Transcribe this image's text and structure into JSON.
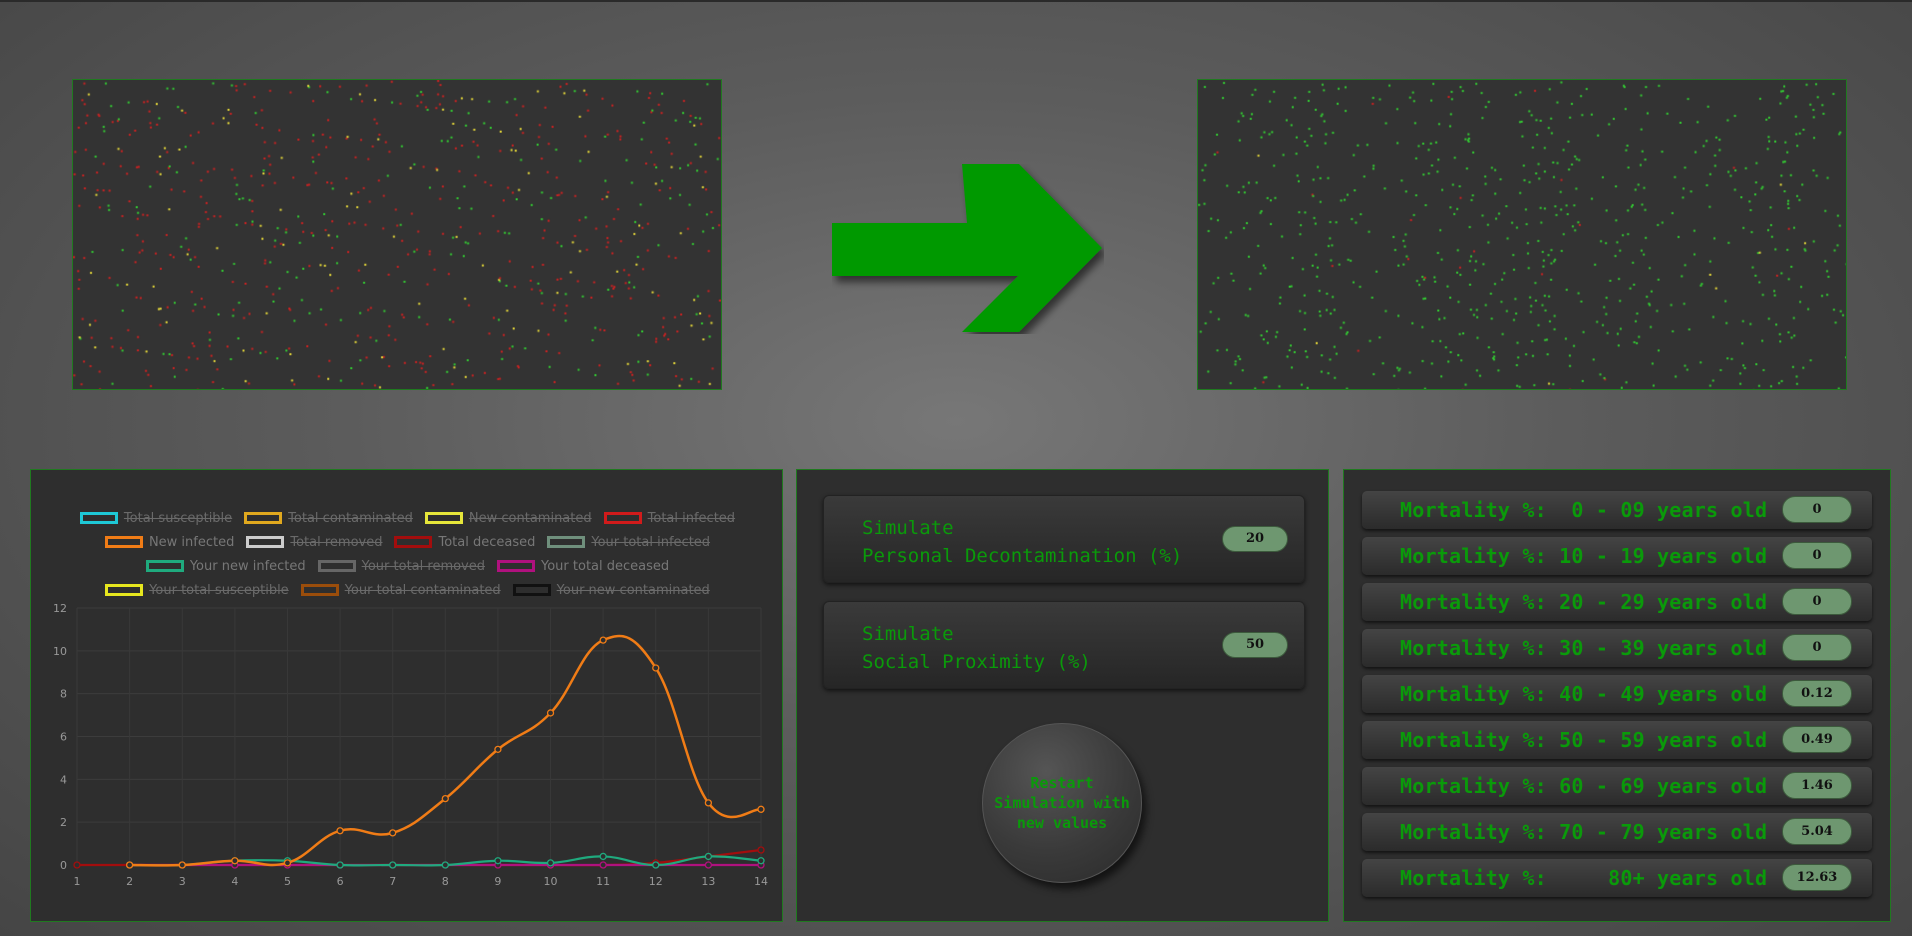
{
  "colors": {
    "accent_green": "#0a9a0a",
    "panel_border": "#1f7a1f",
    "pill_bg": "#6e9770",
    "dot_red": "#cc2222",
    "dot_green": "#33cc33",
    "dot_yellow": "#e6d93a",
    "arrow_green": "#009900"
  },
  "simulation": {
    "before_panel": "infection-simulation-before",
    "after_panel": "infection-simulation-after",
    "arrow_icon": "right-arrow-icon"
  },
  "chart_data": {
    "type": "line",
    "categories": [
      1,
      2,
      3,
      4,
      5,
      6,
      7,
      8,
      9,
      10,
      11,
      12,
      13,
      14
    ],
    "ylim": [
      0,
      12
    ],
    "yticks": [
      0,
      2,
      4,
      6,
      8,
      10,
      12
    ],
    "grid": true,
    "legend_position": "top",
    "legend": [
      {
        "name": "Total susceptible",
        "color": "#1ec8d6",
        "hidden": true
      },
      {
        "name": "Total contaminated",
        "color": "#e0a81e",
        "hidden": true
      },
      {
        "name": "New contaminated",
        "color": "#e6e63a",
        "hidden": true
      },
      {
        "name": "Total infected",
        "color": "#d11b1b",
        "hidden": true
      },
      {
        "name": "New infected",
        "color": "#f07c16",
        "hidden": false
      },
      {
        "name": "Total removed",
        "color": "#cccccc",
        "hidden": true
      },
      {
        "name": "Total deceased",
        "color": "#a30d0d",
        "hidden": false
      },
      {
        "name": "Your total infected",
        "color": "#6f8f7c",
        "hidden": true
      },
      {
        "name": "Your new infected",
        "color": "#1faa7e",
        "hidden": false
      },
      {
        "name": "Your total removed",
        "color": "#666666",
        "hidden": true
      },
      {
        "name": "Your total deceased",
        "color": "#b0117e",
        "hidden": false
      },
      {
        "name": "Your total susceptible",
        "color": "#e6e61e",
        "hidden": true
      },
      {
        "name": "Your total contaminated",
        "color": "#9a4d0b",
        "hidden": true
      },
      {
        "name": "Your new contaminated",
        "color": "#111111",
        "hidden": true
      }
    ],
    "series": [
      {
        "name": "New infected",
        "color": "#f07c16",
        "values": [
          null,
          0,
          0,
          0.2,
          0.1,
          1.6,
          1.5,
          3.1,
          5.4,
          7.1,
          10.5,
          9.2,
          2.9,
          2.6
        ]
      },
      {
        "name": "Total deceased",
        "color": "#a30d0d",
        "values": [
          0,
          0,
          0,
          0,
          0,
          0,
          0,
          0,
          0,
          0,
          0,
          0.1,
          0.4,
          0.7
        ]
      },
      {
        "name": "Your new infected",
        "color": "#1faa7e",
        "values": [
          null,
          0,
          0,
          0.2,
          0.2,
          0,
          0,
          0,
          0.2,
          0.1,
          0.4,
          0,
          0.4,
          0.2
        ]
      },
      {
        "name": "Your total deceased",
        "color": "#b0117e",
        "values": [
          null,
          0,
          0,
          0,
          0,
          0,
          0,
          0,
          0,
          0,
          0,
          0,
          0,
          0
        ]
      }
    ]
  },
  "controls": {
    "decontamination": {
      "label": "Simulate\nPersonal Decontamination (%)",
      "value": "20"
    },
    "proximity": {
      "label": "Simulate\nSocial Proximity (%)",
      "value": "50"
    },
    "restart_label": "Restart Simulation with new values"
  },
  "mortality": [
    {
      "label": "Mortality %:  0 - 09 years old",
      "value": "0"
    },
    {
      "label": "Mortality %: 10 - 19 years old",
      "value": "0"
    },
    {
      "label": "Mortality %: 20 - 29 years old",
      "value": "0"
    },
    {
      "label": "Mortality %: 30 - 39 years old",
      "value": "0"
    },
    {
      "label": "Mortality %: 40 - 49 years old",
      "value": "0.12"
    },
    {
      "label": "Mortality %: 50 - 59 years old",
      "value": "0.49"
    },
    {
      "label": "Mortality %: 60 - 69 years old",
      "value": "1.46"
    },
    {
      "label": "Mortality %: 70 - 79 years old",
      "value": "5.04"
    },
    {
      "label": "Mortality %:     80+ years old",
      "value": "12.63"
    }
  ]
}
